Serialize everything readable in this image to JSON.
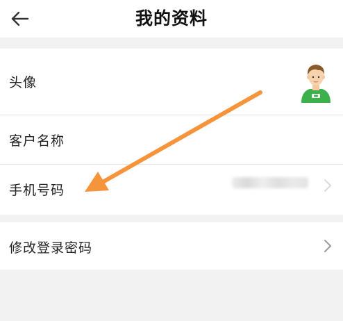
{
  "header": {
    "title": "我的资料",
    "back_icon": "back-arrow-icon"
  },
  "profile": {
    "avatar_label": "头像",
    "customer_name_label": "客户名称",
    "phone_label": "手机号码"
  },
  "security": {
    "change_password_label": "修改登录密码",
    "chevron_icon": "chevron-right-icon"
  },
  "colors": {
    "annotation_arrow": "#f5943a",
    "avatar_shirt": "#3cb04a",
    "divider": "#e4e4e4",
    "page_background": "#f2f2f2"
  }
}
